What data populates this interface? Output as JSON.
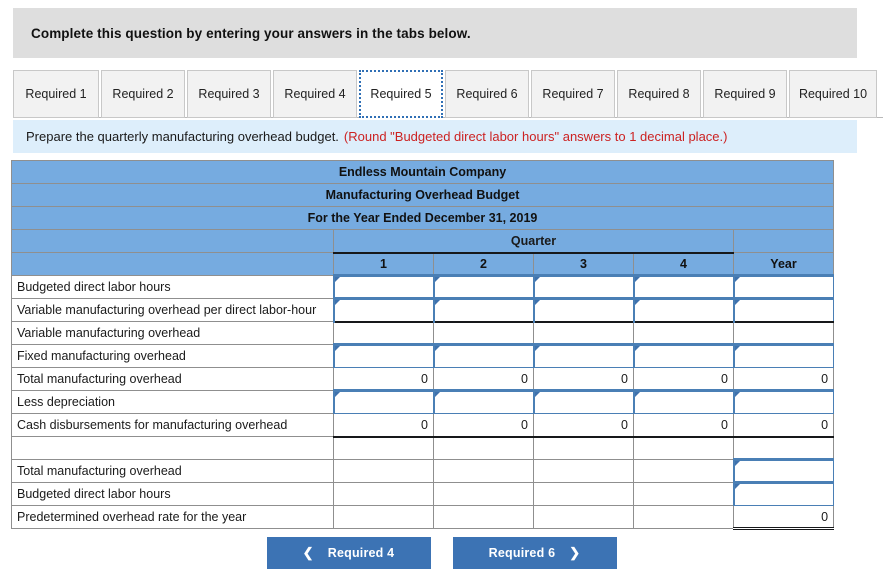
{
  "banner": {
    "instruction": "Complete this question by entering your answers in the tabs below."
  },
  "tabs": {
    "items": [
      {
        "label": "Required 1",
        "selected": false
      },
      {
        "label": "Required 2",
        "selected": false
      },
      {
        "label": "Required 3",
        "selected": false
      },
      {
        "label": "Required 4",
        "selected": false
      },
      {
        "label": "Required 5",
        "selected": true
      },
      {
        "label": "Required 6",
        "selected": false
      },
      {
        "label": "Required 7",
        "selected": false
      },
      {
        "label": "Required 8",
        "selected": false
      },
      {
        "label": "Required 9",
        "selected": false
      },
      {
        "label": "Required 10",
        "selected": false
      }
    ]
  },
  "requirement": {
    "text": "Prepare the quarterly manufacturing overhead budget.",
    "note": "(Round \"Budgeted direct labor hours\" answers to 1 decimal place.)",
    "note_color": "#cc2222"
  },
  "worksheet": {
    "title_lines": [
      "Endless Mountain Company",
      "Manufacturing Overhead Budget",
      "For the Year Ended December 31, 2019"
    ],
    "group_header": "Quarter",
    "column_headers": [
      "1",
      "2",
      "3",
      "4"
    ],
    "year_header": "Year",
    "header_color": "#76abe0",
    "rows": [
      {
        "label": "Budgeted direct labor hours",
        "type": "input",
        "values": [
          "",
          "",
          "",
          "",
          ""
        ]
      },
      {
        "label": "Variable manufacturing overhead per direct labor-hour",
        "type": "input",
        "values": [
          "",
          "",
          "",
          "",
          ""
        ]
      },
      {
        "label": "Variable manufacturing overhead",
        "type": "computed",
        "values": [
          "",
          "",
          "",
          "",
          ""
        ]
      },
      {
        "label": "Fixed manufacturing overhead",
        "type": "input",
        "values": [
          "",
          "",
          "",
          "",
          ""
        ]
      },
      {
        "label": "Total manufacturing overhead",
        "type": "computed",
        "values": [
          "0",
          "0",
          "0",
          "0",
          "0"
        ]
      },
      {
        "label": "Less depreciation",
        "type": "input",
        "values": [
          "",
          "",
          "",
          "",
          ""
        ]
      },
      {
        "label": "Cash disbursements for manufacturing overhead",
        "type": "computed",
        "values": [
          "0",
          "0",
          "0",
          "0",
          "0"
        ]
      },
      {
        "label": "",
        "type": "spacer",
        "values": [
          "",
          "",
          "",
          "",
          ""
        ]
      },
      {
        "label": "Total manufacturing overhead",
        "type": "year-input",
        "values": [
          "",
          "",
          "",
          "",
          ""
        ]
      },
      {
        "label": "Budgeted direct labor hours",
        "type": "year-input",
        "values": [
          "",
          "",
          "",
          "",
          ""
        ]
      },
      {
        "label": "Predetermined overhead rate for the year",
        "type": "year-computed",
        "values": [
          "",
          "",
          "",
          "",
          "0"
        ]
      }
    ]
  },
  "navigation": {
    "prev_label": "Required 4",
    "next_label": "Required 6",
    "prev_icon": "chevron-left-icon",
    "next_icon": "chevron-right-icon",
    "button_color": "#3c73b4"
  }
}
